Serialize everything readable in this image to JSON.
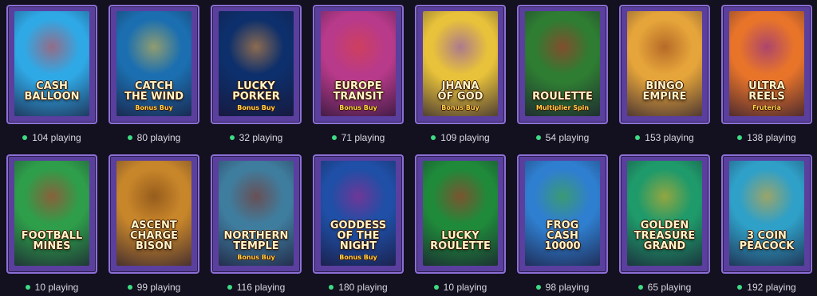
{
  "games": [
    {
      "title": "Cash\nBalloon",
      "subtitle": "",
      "players": "104 playing",
      "bg": "#2fa9e6",
      "accent": "#e83a3a",
      "icon": "hot-air-balloon-icon"
    },
    {
      "title": "Catch\nthe Wind",
      "subtitle": "Bonus Buy",
      "players": "80 playing",
      "bg": "#1b6fb0",
      "accent": "#f0c23c",
      "icon": "pirate-icon"
    },
    {
      "title": "Lucky\nPorker",
      "subtitle": "Bonus Buy",
      "players": "32 playing",
      "bg": "#0d2f6b",
      "accent": "#f39c3b",
      "icon": "pig-icon"
    },
    {
      "title": "Europe\nTransit",
      "subtitle": "Bonus Buy",
      "players": "71 playing",
      "bg": "#b83a8a",
      "accent": "#e0443c",
      "icon": "traveler-icon"
    },
    {
      "title": "Jhana\nof God",
      "subtitle": "Bonus Buy",
      "players": "109 playing",
      "bg": "#e8c23a",
      "accent": "#7a3fd0",
      "icon": "buddha-icon"
    },
    {
      "title": "Roulette",
      "subtitle": "Multiplier Spin",
      "players": "54 playing",
      "bg": "#2e7d32",
      "accent": "#c62828",
      "icon": "roulette-wheel-icon"
    },
    {
      "title": "Bingo\nEmpire",
      "subtitle": "",
      "players": "153 playing",
      "bg": "#e6a53a",
      "accent": "#8e3b1a",
      "icon": "pyramid-icon"
    },
    {
      "title": "Ultra\nReels",
      "subtitle": "Fruteria",
      "players": "138 playing",
      "bg": "#e8742a",
      "accent": "#7b1fa2",
      "icon": "fruit-icon"
    },
    {
      "title": "Football\nMines",
      "subtitle": "",
      "players": "10 playing",
      "bg": "#2e9e4a",
      "accent": "#d32f2f",
      "icon": "football-player-icon"
    },
    {
      "title": "Ascent\nCharge\nBison",
      "subtitle": "",
      "players": "99 playing",
      "bg": "#c8862a",
      "accent": "#6d3a12",
      "icon": "bison-icon"
    },
    {
      "title": "Northern\nTemple",
      "subtitle": "Bonus Buy",
      "players": "116 playing",
      "bg": "#3f7d9e",
      "accent": "#8a2a1a",
      "icon": "temple-icon"
    },
    {
      "title": "Goddess\nof the\nNight",
      "subtitle": "Bonus Buy",
      "players": "180 playing",
      "bg": "#1f4fa6",
      "accent": "#b0248c",
      "icon": "goddess-icon"
    },
    {
      "title": "Lucky\nRoulette",
      "subtitle": "",
      "players": "10 playing",
      "bg": "#1f8a3a",
      "accent": "#c62828",
      "icon": "roulette-wheel-icon"
    },
    {
      "title": "Frog\nCash\n10000",
      "subtitle": "",
      "players": "98 playing",
      "bg": "#2f7fd0",
      "accent": "#43b02a",
      "icon": "frog-icon"
    },
    {
      "title": "Golden\nTreasure\nGrand",
      "subtitle": "",
      "players": "65 playing",
      "bg": "#1f9a6a",
      "accent": "#f0b020",
      "icon": "prize-wheel-icon"
    },
    {
      "title": "3 Coin\nPeacock",
      "subtitle": "",
      "players": "192 playing",
      "bg": "#2fa0c8",
      "accent": "#f2a81d",
      "icon": "peacock-icon"
    }
  ]
}
